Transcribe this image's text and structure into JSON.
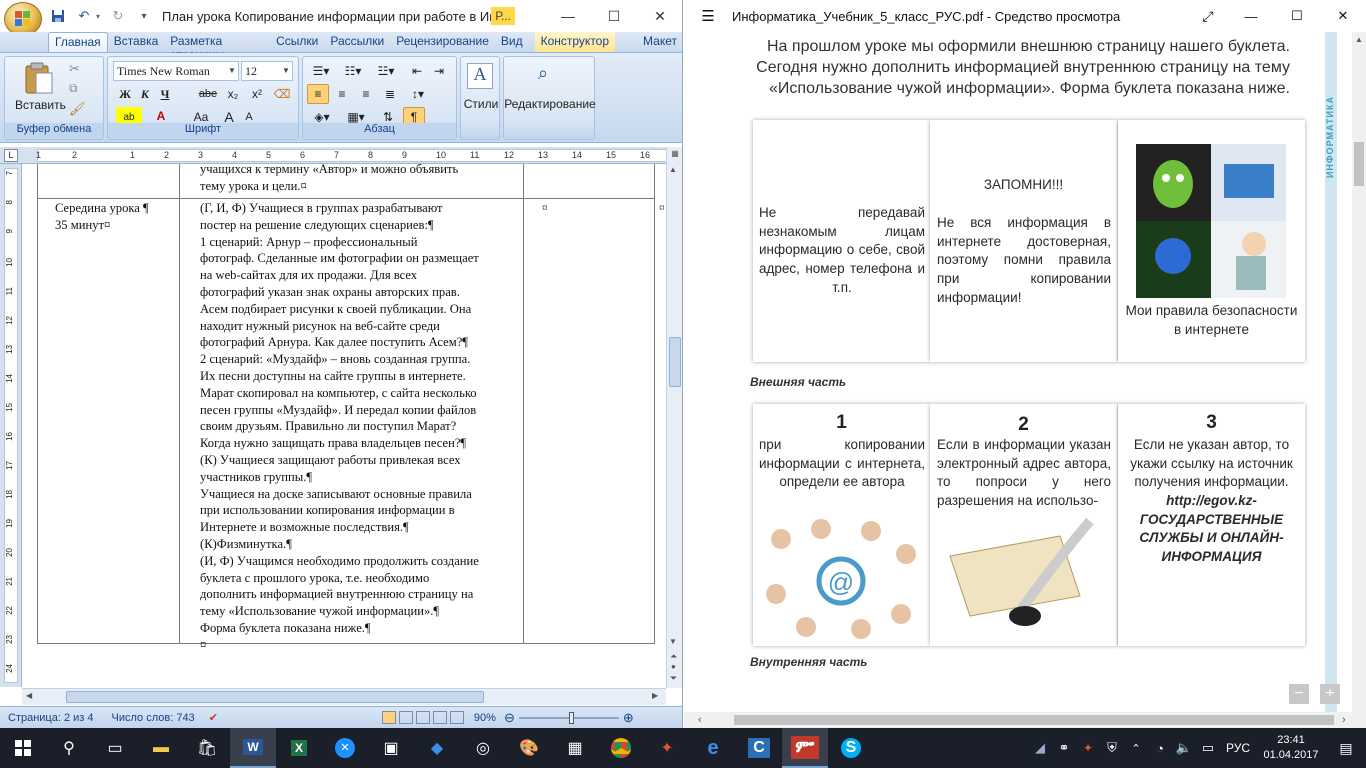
{
  "word": {
    "title": "План урока Копирование информации при работе в Интер...",
    "title_tag": "Р...",
    "tabs": [
      "Главная",
      "Вставка",
      "Разметка страницы",
      "Ссылки",
      "Рассылки",
      "Рецензирование",
      "Вид",
      "Конструктор",
      "Макет"
    ],
    "ribbon": {
      "paste_label": "Вставить",
      "clipboard_label": "Буфер обмена",
      "font_name": "Times New Roman",
      "font_size": "12",
      "font_label": "Шрифт",
      "paragraph_label": "Абзац",
      "styles_label": "Стили",
      "editing_label": "Редактирование",
      "bold": "Ж",
      "italic": "К",
      "underline": "Ч",
      "strike": "abe",
      "sub": "x₂",
      "sup": "x²",
      "case": "Aa",
      "grow": "A",
      "shrink": "A",
      "pilcrow": "¶"
    },
    "ruler_numbers": [
      "1",
      "2",
      "1",
      "2",
      "3",
      "4",
      "5",
      "6",
      "7",
      "8",
      "9",
      "10",
      "11",
      "12",
      "13",
      "14",
      "15",
      "16",
      "17"
    ],
    "vruler_numbers": [
      "7",
      "8",
      "9",
      "10",
      "11",
      "12",
      "13",
      "14",
      "15",
      "16",
      "17",
      "18",
      "19",
      "20",
      "21",
      "22",
      "23",
      "24"
    ],
    "doc": {
      "top_lines": [
        "учащихся к термину «Автор» и можно объявить",
        "тему урока и цели.¤"
      ],
      "stage": "Середина урока ¶",
      "duration": "35 минут¤",
      "cell_mark": "¤",
      "body_lines": [
        "(Г, И, Ф) Учащиеся  в группах разрабатывают",
        "постер на решение  следующих  сценариев:¶",
        "1 сценарий:  Арнур – профессиональный",
        "фотограф.  Сделанные им фотографии он размещает",
        "на web-сайтах для их продажи.  Для всех",
        "фотографий указан знак охраны авторских прав.",
        "Асем подбирает рисунки к своей публикации. Она",
        "находит нужный рисунок на веб-сайте  среди",
        "фотографий Арнура. Как далее поступить Асем?¶",
        "2 сценарий: «Муздайф» – вновь созданная группа.",
        "Их песни доступны на сайте группы в интернете.",
        "Марат скопировал на компьютер,  с сайта  несколько",
        "песен группы «Муздайф».  И передал копии файлов",
        "своим друзьям. Правильно ли поступил Марат?",
        "Когда нужно защищать права владельцев песен?¶",
        "(К) Учащиеся защищают работы привлекая всех",
        "участников группы.¶",
        "Учащиеся на доске записывают  основные правила",
        "при использовании копирования информации в",
        "Интернете и возможные последствия.¶",
        "(К)Физминутка.¶",
        "(И, Ф) Учащимся необходимо продолжить создание",
        "буклета с прошлого урока,  т.е. необходимо",
        "дополнить информацией внутреннюю страницу на",
        "тему «Использование чужой информации».¶",
        "Форма буклета показана ниже.¶",
        "¤"
      ]
    },
    "status": {
      "page": "Страница: 2 из 4",
      "words": "Число слов: 743",
      "zoom": "90%"
    }
  },
  "pdf": {
    "title": "Информатика_Учебник_5_класс_РУС.pdf - Средство просмотра",
    "intro": [
      "На прошлом уроке мы оформили внешнюю страницу нашего буклета.",
      "Сегодня нужно дополнить информацией внутреннюю страницу на тему",
      "«Использование чужой информации». Форма буклета показана ниже."
    ],
    "side_label": "ИНФОРМАТИКА",
    "outer": {
      "card1": "Не передавай незнакомым лицам информацию о себе, свой адрес, номер телефона и т.п.",
      "card2_head": "ЗАПОМНИ!!!",
      "card2": "Не вся информация в интернете достоверная, поэтому помни правила при копировании информации!",
      "card3": "Мои правила безопасности в интернете",
      "caption": "Внешняя часть"
    },
    "inner": {
      "n1": "1",
      "card1": "при копировании информации с интернета, определи ее автора",
      "n2": "2",
      "card2": "Если в информации указан электронный адрес автора, то попроси у него разрешения на использо-",
      "n3": "3",
      "card3": "Если не указан автор, то укажи ссылку на источник получения информации.",
      "card3_bold": "http://egov.kz- ГОСУДАРСТВЕННЫЕ СЛУЖБЫ И ОНЛАЙН-ИНФОРМАЦИЯ",
      "caption": "Внутренняя часть"
    },
    "zoom_minus": "−",
    "zoom_plus": "+"
  },
  "taskbar": {
    "lang": "РУС",
    "time": "23:41",
    "date": "01.04.2017"
  },
  "colors": {
    "word_blue": "#2b5797",
    "ribbon_bg": "#dae6f5",
    "pdf_accent": "#3aa0c8",
    "taskbar": "#1b1f2a"
  }
}
